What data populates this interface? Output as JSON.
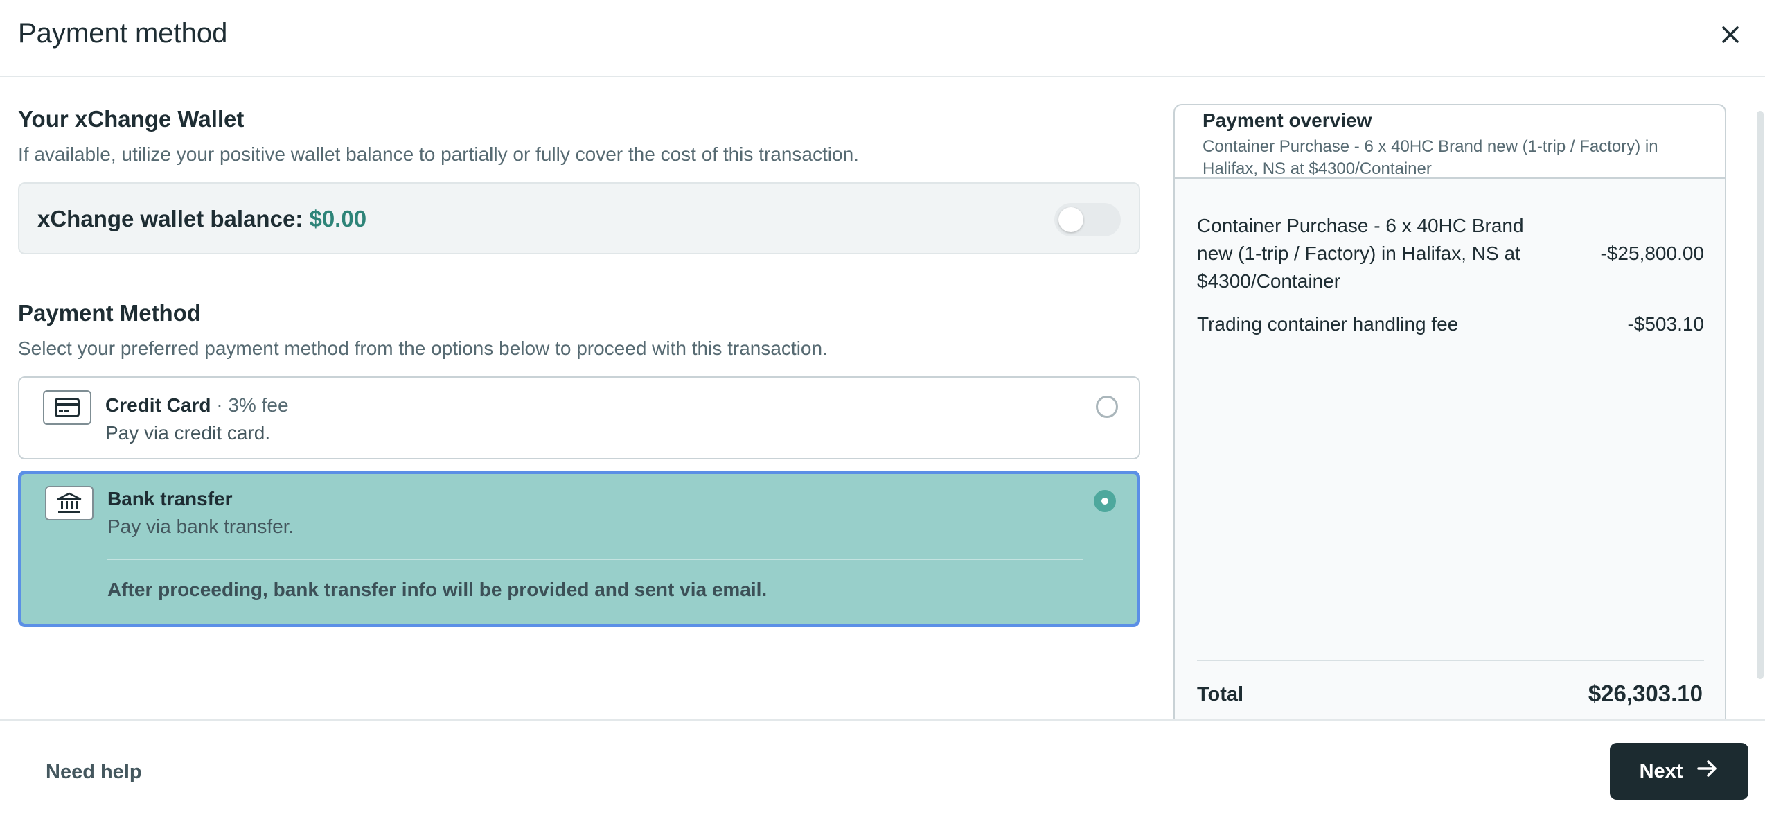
{
  "header": {
    "title": "Payment method",
    "close_icon": "close-icon"
  },
  "wallet": {
    "title": "Your xChange Wallet",
    "subtitle": "If available, utilize your positive wallet balance to partially or fully cover the cost of this transaction.",
    "balance_label": "xChange wallet balance:",
    "balance_value": "$0.00",
    "toggle_on": false
  },
  "payment": {
    "title": "Payment Method",
    "subtitle": "Select your preferred payment method from the options below to proceed with this transaction.",
    "options": [
      {
        "icon": "credit-card-icon",
        "title": "Credit Card",
        "fee": "· 3% fee",
        "description": "Pay via credit card.",
        "selected": false
      },
      {
        "icon": "bank-icon",
        "title": "Bank transfer",
        "description": "Pay via bank transfer.",
        "note": "After proceeding, bank transfer info will be provided and sent via email.",
        "selected": true
      }
    ]
  },
  "overview": {
    "title": "Payment overview",
    "subtitle": "Container Purchase - 6 x 40HC Brand new (1-trip / Factory) in Halifax, NS at $4300/Container",
    "items": [
      {
        "label": "Container Purchase - 6 x 40HC Brand new (1-trip / Factory) in Halifax, NS at $4300/Container",
        "value": "-$25,800.00"
      },
      {
        "label": "Trading container handling fee",
        "value": "-$503.10"
      }
    ],
    "total_label": "Total",
    "total_value": "$26,303.10"
  },
  "footer": {
    "help_label": "Need help",
    "next_label": "Next"
  },
  "colors": {
    "accent": "#2e8478",
    "selected_bg": "#98cfca",
    "selected_border": "#5b8fe6",
    "primary_button": "#1c2b30"
  }
}
